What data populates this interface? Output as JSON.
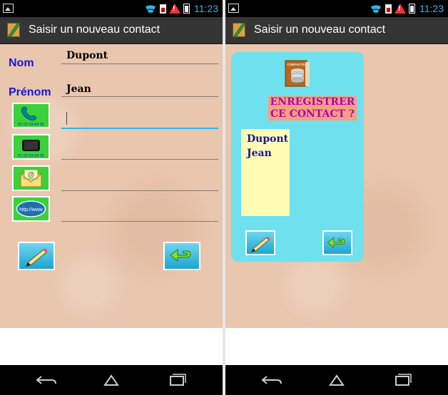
{
  "status_bar": {
    "time": "11:23",
    "icons": [
      "image-icon",
      "wifi-icon",
      "sim-icon",
      "warning-icon",
      "battery-icon"
    ]
  },
  "app": {
    "title": "Saisir un nouveau contact",
    "icon": "notepad-pencil-icon"
  },
  "left_screen": {
    "fields": [
      {
        "label": "Nom",
        "value": "Dupont"
      },
      {
        "label": "Prénom",
        "value": "Jean"
      }
    ],
    "phone_number_sample": "01 02 03 04 05",
    "web_label": "http://www",
    "icon_fields": [
      "phone-icon",
      "mobile-icon",
      "email-icon",
      "web-icon"
    ],
    "save_button_icon": "pencil-icon",
    "back_button_icon": "return-arrow-icon"
  },
  "right_screen": {
    "prompt": "ENREGISTRER CE CONTACT ?",
    "book_label": "CONTACTS",
    "contact_lines": [
      "Dupont",
      "Jean"
    ],
    "confirm_icon": "pencil-icon",
    "back_icon": "return-arrow-icon"
  },
  "navigation": [
    "back-icon",
    "home-icon",
    "recent-apps-icon"
  ],
  "colors": {
    "label_blue": "#1515e0",
    "accent": "#33b5e5",
    "button_green": "#3ad13a",
    "dialog_cyan": "#6fe1ee",
    "prompt_bg": "#f5a07e",
    "prompt_text": "#b300b3"
  }
}
